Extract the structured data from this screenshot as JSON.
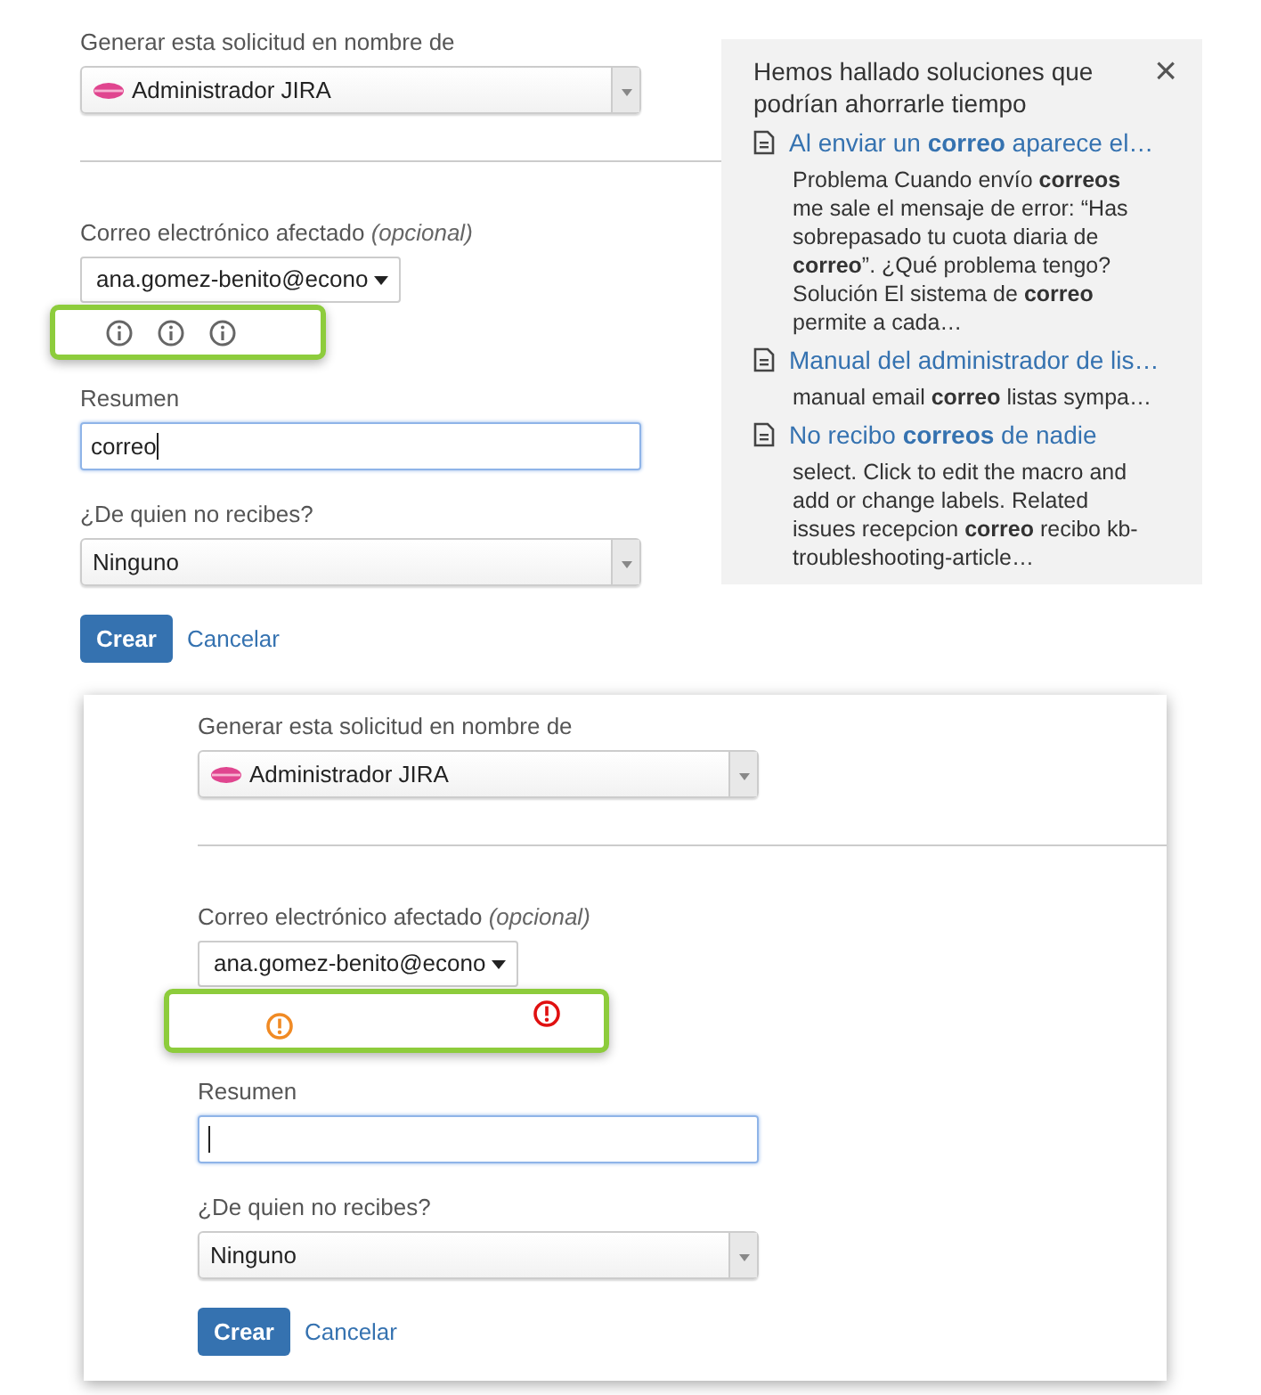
{
  "panels": [
    {
      "requester": {
        "label": "Generar esta solicitud en nombre de",
        "value": "Administrador JIRA"
      },
      "email": {
        "label": "Correo electrónico afectado",
        "optional": "(opcional)",
        "value": "ana.gomez-benito@econo"
      },
      "markers": [
        {
          "kind": "info"
        },
        {
          "kind": "info"
        },
        {
          "kind": "info"
        }
      ],
      "summary": {
        "label": "Resumen",
        "value": "correo",
        "focused": true
      },
      "from_whom": {
        "label": "¿De quien no recibes?",
        "value": "Ninguno"
      },
      "buttons": {
        "create": "Crear",
        "cancel": "Cancelar"
      },
      "suggestions": {
        "title": "Hemos hallado soluciones que podrían ahorrarle tiempo",
        "close": "×",
        "items": [
          {
            "title": "Al enviar un **correo** aparece el…",
            "snippet": "Problema Cuando envío **correos** me sale el mensaje de error: “Has sobrepasado tu cuota diaria de **correo**”. ¿Qué problema tengo? Solución El sistema de **correo** permite a cada…"
          },
          {
            "title": "Manual del administrador de lis…",
            "snippet": "manual email **correo** listas sympa…"
          },
          {
            "title": "No recibo **correos** de nadie",
            "snippet": "select. Click to edit the macro and add or change labels. Related issues recepcion **correo** recibo kb-troubleshooting-article…"
          }
        ]
      }
    },
    {
      "requester": {
        "label": "Generar esta solicitud en nombre de",
        "value": "Administrador JIRA"
      },
      "email": {
        "label": "Correo electrónico afectado",
        "optional": "(opcional)",
        "value": "ana.gomez-benito@econo"
      },
      "markers": [
        {
          "kind": "warning"
        },
        {
          "kind": "error"
        }
      ],
      "summary": {
        "label": "Resumen",
        "focused": true
      },
      "from_whom": {
        "label": "¿De quien no recibes?",
        "value": "Ninguno"
      },
      "buttons": {
        "create": "Crear",
        "cancel": "Cancelar"
      }
    }
  ]
}
